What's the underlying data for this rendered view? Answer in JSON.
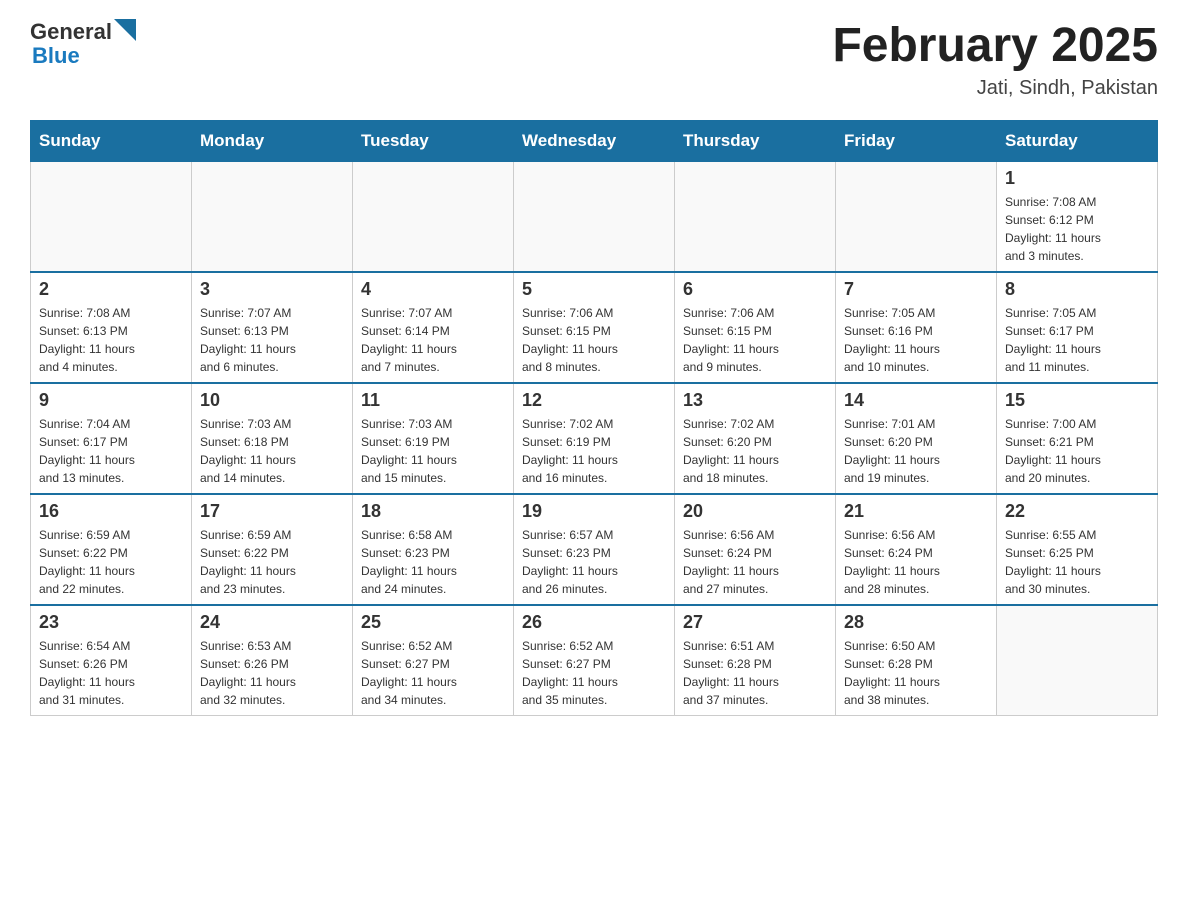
{
  "header": {
    "logo": {
      "general": "General",
      "blue": "Blue"
    },
    "title": "February 2025",
    "subtitle": "Jati, Sindh, Pakistan"
  },
  "days_of_week": [
    "Sunday",
    "Monday",
    "Tuesday",
    "Wednesday",
    "Thursday",
    "Friday",
    "Saturday"
  ],
  "weeks": [
    [
      {
        "day": "",
        "info": ""
      },
      {
        "day": "",
        "info": ""
      },
      {
        "day": "",
        "info": ""
      },
      {
        "day": "",
        "info": ""
      },
      {
        "day": "",
        "info": ""
      },
      {
        "day": "",
        "info": ""
      },
      {
        "day": "1",
        "info": "Sunrise: 7:08 AM\nSunset: 6:12 PM\nDaylight: 11 hours\nand 3 minutes."
      }
    ],
    [
      {
        "day": "2",
        "info": "Sunrise: 7:08 AM\nSunset: 6:13 PM\nDaylight: 11 hours\nand 4 minutes."
      },
      {
        "day": "3",
        "info": "Sunrise: 7:07 AM\nSunset: 6:13 PM\nDaylight: 11 hours\nand 6 minutes."
      },
      {
        "day": "4",
        "info": "Sunrise: 7:07 AM\nSunset: 6:14 PM\nDaylight: 11 hours\nand 7 minutes."
      },
      {
        "day": "5",
        "info": "Sunrise: 7:06 AM\nSunset: 6:15 PM\nDaylight: 11 hours\nand 8 minutes."
      },
      {
        "day": "6",
        "info": "Sunrise: 7:06 AM\nSunset: 6:15 PM\nDaylight: 11 hours\nand 9 minutes."
      },
      {
        "day": "7",
        "info": "Sunrise: 7:05 AM\nSunset: 6:16 PM\nDaylight: 11 hours\nand 10 minutes."
      },
      {
        "day": "8",
        "info": "Sunrise: 7:05 AM\nSunset: 6:17 PM\nDaylight: 11 hours\nand 11 minutes."
      }
    ],
    [
      {
        "day": "9",
        "info": "Sunrise: 7:04 AM\nSunset: 6:17 PM\nDaylight: 11 hours\nand 13 minutes."
      },
      {
        "day": "10",
        "info": "Sunrise: 7:03 AM\nSunset: 6:18 PM\nDaylight: 11 hours\nand 14 minutes."
      },
      {
        "day": "11",
        "info": "Sunrise: 7:03 AM\nSunset: 6:19 PM\nDaylight: 11 hours\nand 15 minutes."
      },
      {
        "day": "12",
        "info": "Sunrise: 7:02 AM\nSunset: 6:19 PM\nDaylight: 11 hours\nand 16 minutes."
      },
      {
        "day": "13",
        "info": "Sunrise: 7:02 AM\nSunset: 6:20 PM\nDaylight: 11 hours\nand 18 minutes."
      },
      {
        "day": "14",
        "info": "Sunrise: 7:01 AM\nSunset: 6:20 PM\nDaylight: 11 hours\nand 19 minutes."
      },
      {
        "day": "15",
        "info": "Sunrise: 7:00 AM\nSunset: 6:21 PM\nDaylight: 11 hours\nand 20 minutes."
      }
    ],
    [
      {
        "day": "16",
        "info": "Sunrise: 6:59 AM\nSunset: 6:22 PM\nDaylight: 11 hours\nand 22 minutes."
      },
      {
        "day": "17",
        "info": "Sunrise: 6:59 AM\nSunset: 6:22 PM\nDaylight: 11 hours\nand 23 minutes."
      },
      {
        "day": "18",
        "info": "Sunrise: 6:58 AM\nSunset: 6:23 PM\nDaylight: 11 hours\nand 24 minutes."
      },
      {
        "day": "19",
        "info": "Sunrise: 6:57 AM\nSunset: 6:23 PM\nDaylight: 11 hours\nand 26 minutes."
      },
      {
        "day": "20",
        "info": "Sunrise: 6:56 AM\nSunset: 6:24 PM\nDaylight: 11 hours\nand 27 minutes."
      },
      {
        "day": "21",
        "info": "Sunrise: 6:56 AM\nSunset: 6:24 PM\nDaylight: 11 hours\nand 28 minutes."
      },
      {
        "day": "22",
        "info": "Sunrise: 6:55 AM\nSunset: 6:25 PM\nDaylight: 11 hours\nand 30 minutes."
      }
    ],
    [
      {
        "day": "23",
        "info": "Sunrise: 6:54 AM\nSunset: 6:26 PM\nDaylight: 11 hours\nand 31 minutes."
      },
      {
        "day": "24",
        "info": "Sunrise: 6:53 AM\nSunset: 6:26 PM\nDaylight: 11 hours\nand 32 minutes."
      },
      {
        "day": "25",
        "info": "Sunrise: 6:52 AM\nSunset: 6:27 PM\nDaylight: 11 hours\nand 34 minutes."
      },
      {
        "day": "26",
        "info": "Sunrise: 6:52 AM\nSunset: 6:27 PM\nDaylight: 11 hours\nand 35 minutes."
      },
      {
        "day": "27",
        "info": "Sunrise: 6:51 AM\nSunset: 6:28 PM\nDaylight: 11 hours\nand 37 minutes."
      },
      {
        "day": "28",
        "info": "Sunrise: 6:50 AM\nSunset: 6:28 PM\nDaylight: 11 hours\nand 38 minutes."
      },
      {
        "day": "",
        "info": ""
      }
    ]
  ]
}
